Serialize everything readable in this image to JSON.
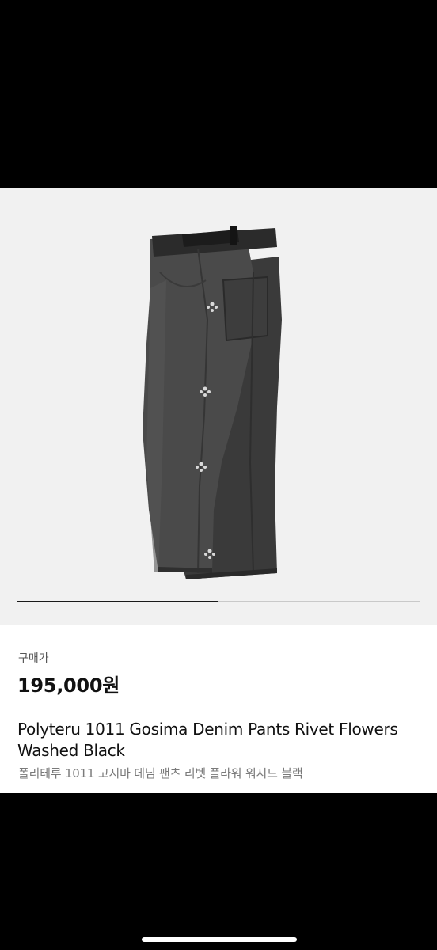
{
  "gallery": {
    "image_alt": "Polyteru 1011 Gosima Denim Pants Rivet Flowers Washed Black",
    "progress": 0.5
  },
  "product": {
    "price_label": "구매가",
    "price": "195,000원",
    "title": "Polyteru 1011 Gosima Denim Pants Rivet Flowers Washed Black",
    "subtitle": "폴리테루 1011 고시마 데님 팬츠 리벳 플라워 워시드 블랙"
  },
  "colors": {
    "image_background": "#f1f1f1",
    "progress_track": "#c9c9c9",
    "progress_fill": "#1a1a1a"
  }
}
